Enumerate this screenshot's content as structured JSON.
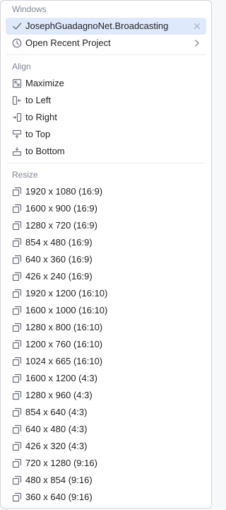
{
  "windows": {
    "header": "Windows",
    "current_window": "JosephGuadagnoNet.Broadcasting",
    "open_recent": "Open Recent Project"
  },
  "align": {
    "header": "Align",
    "maximize": "Maximize",
    "to_left": "to Left",
    "to_right": "to Right",
    "to_top": "to Top",
    "to_bottom": "to Bottom"
  },
  "resize": {
    "header": "Resize",
    "items": [
      "1920 x 1080 (16:9)",
      "1600 x 900 (16:9)",
      "1280 x 720 (16:9)",
      "854 x 480 (16:9)",
      "640 x 360 (16:9)",
      "426 x 240 (16:9)",
      "1920 x 1200 (16:10)",
      "1600 x 1000 (16:10)",
      "1280 x 800 (16:10)",
      "1200 x 760 (16:10)",
      "1024 x 665 (16:10)",
      "1600 x 1200 (4:3)",
      "1280 x 960 (4:3)",
      "854 x 640 (4:3)",
      "640 x 480 (4:3)",
      "426 x 320 (4:3)",
      "720 x 1280 (9:16)",
      "480 x 854 (9:16)",
      "360 x 640 (9:16)"
    ]
  },
  "icons": {
    "current": "checkmark-icon",
    "recent": "clock-icon",
    "close": "close-icon",
    "submenu": "chevron-right-icon",
    "resize": "resize-icon"
  },
  "colors": {
    "selected_bg": "#dfe9fc",
    "header_text": "#818594",
    "icon": "#6c707e"
  }
}
